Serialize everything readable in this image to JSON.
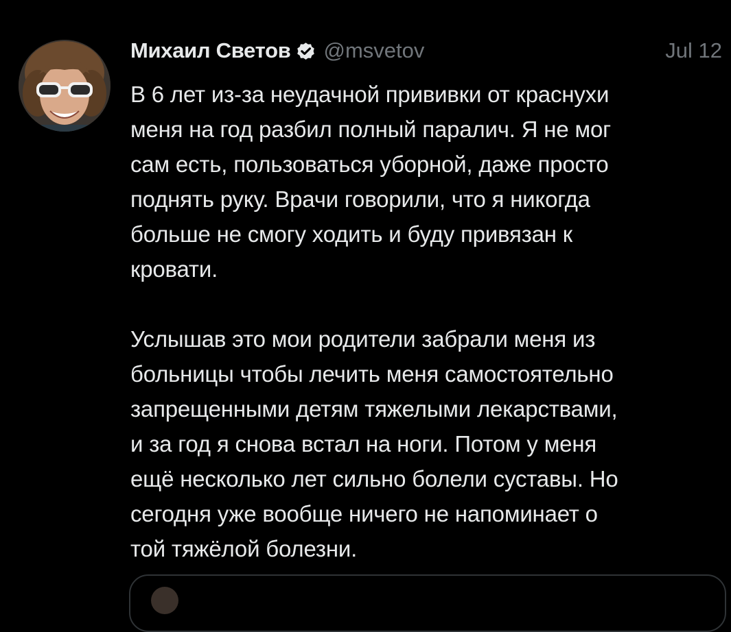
{
  "tweet": {
    "author_name": "Михаил Светов",
    "handle": "@msvetov",
    "date": "Jul 12",
    "paragraph_1": [
      "В 6 лет из-за неудачной прививки от краснухи",
      "меня на год разбил полный паралич. Я не мог",
      "сам есть, пользоваться уборной, даже просто",
      "поднять руку. Врачи говорили, что я никогда",
      "больше не смогу ходить и буду привязан к",
      "кровати."
    ],
    "paragraph_2": [
      "Услышав это мои родители забрали меня из",
      "больницы чтобы лечить меня самостоятельно",
      "запрещенными детям тяжелыми лекарствами,",
      "и за год я снова встал на ноги. Потом у меня",
      "ещё несколько лет сильно болели суставы. Но",
      "сегодня уже вообще ничего не напоминает о",
      "той тяжёлой болезни."
    ]
  },
  "colors": {
    "background": "#000000",
    "text_primary": "#e7e9ea",
    "text_secondary": "#71767b",
    "verified_badge": "#e7e9ea",
    "border": "#2f3336"
  },
  "icons": {
    "verified": "verified-badge-icon"
  }
}
